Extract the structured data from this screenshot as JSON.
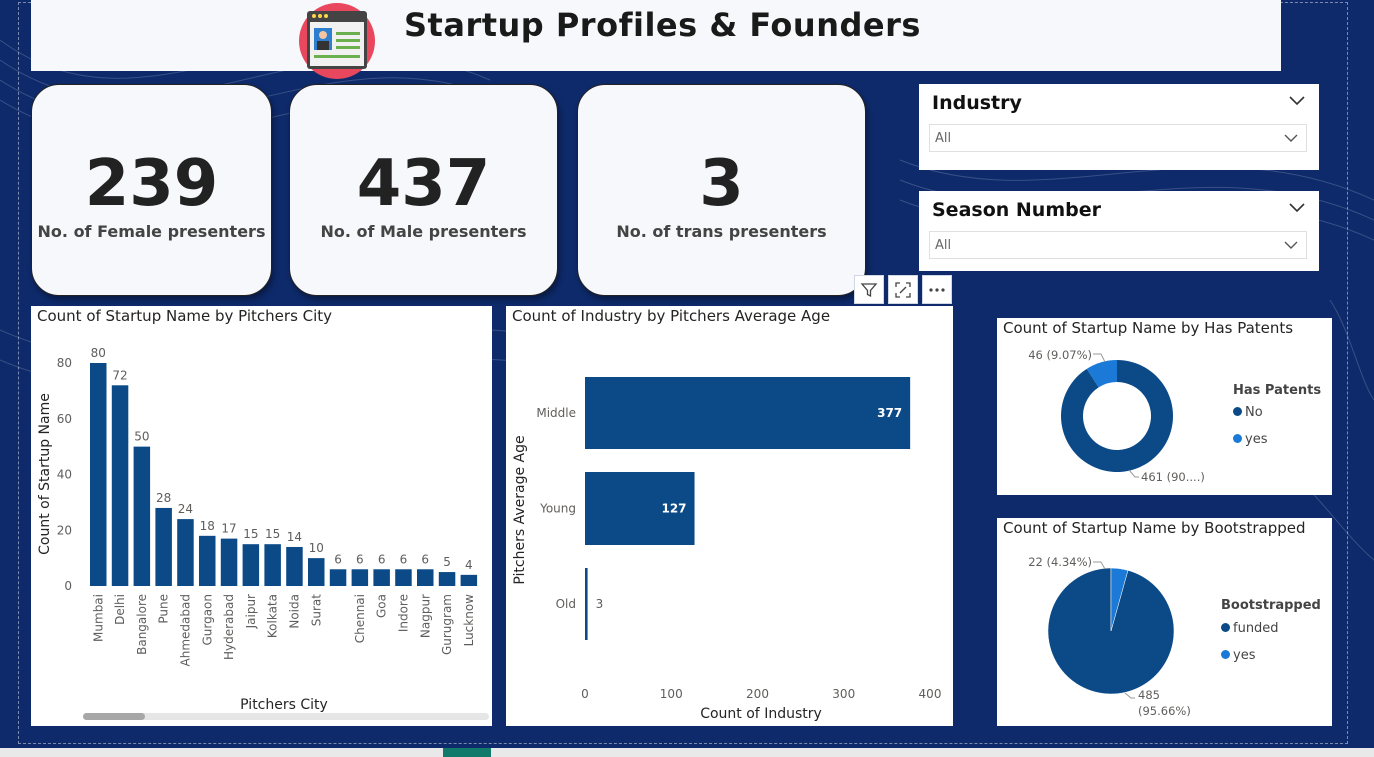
{
  "header": {
    "title": "Startup Profiles & Founders"
  },
  "kpis": [
    {
      "value": "239",
      "label": "No. of Female presenters"
    },
    {
      "value": "437",
      "label": "No. of Male presenters"
    },
    {
      "value": "3",
      "label": "No. of trans presenters"
    }
  ],
  "slicers": [
    {
      "title": "Industry",
      "value": "All"
    },
    {
      "title": "Season Number",
      "value": "All"
    }
  ],
  "colors": {
    "primary": "#0b4a87",
    "accent": "#1b7ad8",
    "background": "#0e2a6b"
  },
  "chart_data": [
    {
      "type": "bar",
      "title": "Count of Startup Name by Pitchers City",
      "xlabel": "Pitchers City",
      "ylabel": "Count of Startup Name",
      "ylim": [
        0,
        80
      ],
      "yticks": [
        "0",
        "20",
        "40",
        "60",
        "80"
      ],
      "categories": [
        "Mumbai",
        "Delhi",
        "Bangalore",
        "Pune",
        "Ahmedabad",
        "Gurgaon",
        "Hyderabad",
        "Jaipur",
        "Kolkata",
        "Noida",
        "Surat",
        "",
        "Chennai",
        "Goa",
        "Indore",
        "Nagpur",
        "Gurugram",
        "Lucknow"
      ],
      "values": [
        80,
        72,
        50,
        28,
        24,
        18,
        17,
        15,
        15,
        14,
        10,
        6,
        6,
        6,
        6,
        6,
        5,
        4
      ],
      "labels": [
        "80",
        "72",
        "50",
        "28",
        "24",
        "18",
        "17",
        "15",
        "15",
        "14",
        "10",
        "6",
        "6",
        "6",
        "6",
        "6",
        "5",
        "4"
      ]
    },
    {
      "type": "bar",
      "orientation": "horizontal",
      "title": "Count of Industry by Pitchers Average Age",
      "xlabel": "Count of Industry",
      "ylabel": "Pitchers Average Age",
      "xlim": [
        0,
        400
      ],
      "xticks": [
        "0",
        "100",
        "200",
        "300",
        "400"
      ],
      "categories": [
        "Middle",
        "Young",
        "Old"
      ],
      "values": [
        377,
        127,
        3
      ],
      "labels": [
        "377",
        "127",
        "3"
      ]
    },
    {
      "type": "pie",
      "donut": true,
      "title": "Count of Startup Name by Has Patents",
      "legend_title": "Has Patents",
      "categories": [
        "No",
        "yes"
      ],
      "values": [
        461,
        46
      ],
      "labels": [
        "461 (90....)",
        "46 (9.07%)"
      ]
    },
    {
      "type": "pie",
      "donut": false,
      "title": "Count of Startup Name by Bootstrapped",
      "legend_title": "Bootstrapped",
      "categories": [
        "funded",
        "yes"
      ],
      "values": [
        485,
        22
      ],
      "labels": [
        "485",
        "(95.66%)",
        "22 (4.34%)"
      ]
    }
  ]
}
